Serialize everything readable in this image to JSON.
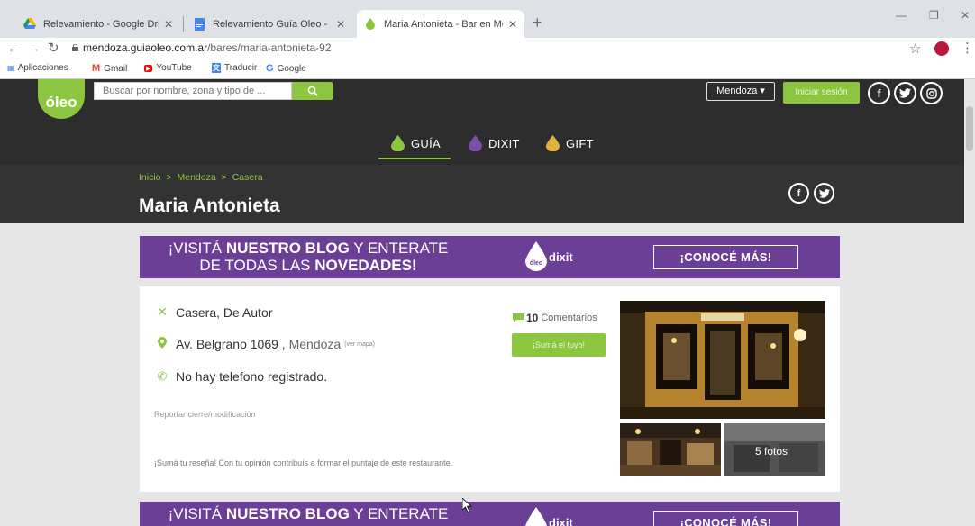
{
  "browser": {
    "tabs": [
      {
        "title": "Relevamiento - Google Drive",
        "close": "✕"
      },
      {
        "title": "Relevamiento Guía Oleo - Docum",
        "close": "✕"
      },
      {
        "title": "Maria Antonieta - Bar en Mendo",
        "close": "✕"
      }
    ],
    "new_tab": "+",
    "url_host": "mendoza.guiaoleo.com.ar",
    "url_path": "/bares/maria-antonieta-92",
    "bookmarks": [
      {
        "label": "Aplicaciones",
        "icon": "apps-grid-icon",
        "glyph": "⋮⋮⋮"
      },
      {
        "label": "Gmail",
        "icon": "gmail-icon",
        "glyph": "M"
      },
      {
        "label": "YouTube",
        "icon": "youtube-icon",
        "glyph": "▶"
      },
      {
        "label": "Traducir",
        "icon": "translate-icon",
        "glyph": "文"
      },
      {
        "label": "Google",
        "icon": "google-icon",
        "glyph": "G"
      }
    ]
  },
  "site": {
    "logo_text": "óleo",
    "search_placeholder": "Buscar por nombre, zona y tipo de ...",
    "city": "Mendoza ▾",
    "login": "Iniciar sesión",
    "social": {
      "facebook": "f",
      "twitter": "t",
      "instagram": "◎"
    },
    "nav": [
      {
        "label": "GUÍA",
        "color": "#8cc540"
      },
      {
        "label": "DIXIT",
        "color": "#7b4fa8"
      },
      {
        "label": "GIFT",
        "color": "#e0b040"
      }
    ],
    "breadcrumb": [
      "Inicio",
      ">",
      "Mendoza",
      ">",
      "Casera"
    ],
    "title": "Maria Antonieta",
    "share": {
      "facebook": "f",
      "twitter": "t"
    }
  },
  "banner": {
    "line1_pre": "¡VISITÁ ",
    "line1_bold": "NUESTRO BLOG",
    "line1_post": " Y ENTERATE",
    "line2_pre": "DE TODAS LAS ",
    "line2_bold": "NOVEDADES!",
    "dixit_logo": "óleo",
    "dixit_word": "dixit",
    "cta": "¡CONOCÉ MÁS!"
  },
  "restaurant": {
    "cuisine": "Casera, De Autor",
    "address": "Av. Belgrano 1069 ,",
    "city": "Mendoza",
    "map_link": "(ver mapa)",
    "phone": "No hay telefono registrado.",
    "report": "Reportar cierre/modificación",
    "review_prompt": "¡Sumá tu reseña! Con tu opinión contribuís a formar el puntaje de este restaurante.",
    "comments_count": "10",
    "comments_label": "Comentarios",
    "add_review": "¡Sumá el tuyo!",
    "photos_label": "5 fotos"
  },
  "colors": {
    "brand_green": "#8cc540",
    "brand_purple": "#6c3f97",
    "header_dark": "#2d2d2d"
  }
}
